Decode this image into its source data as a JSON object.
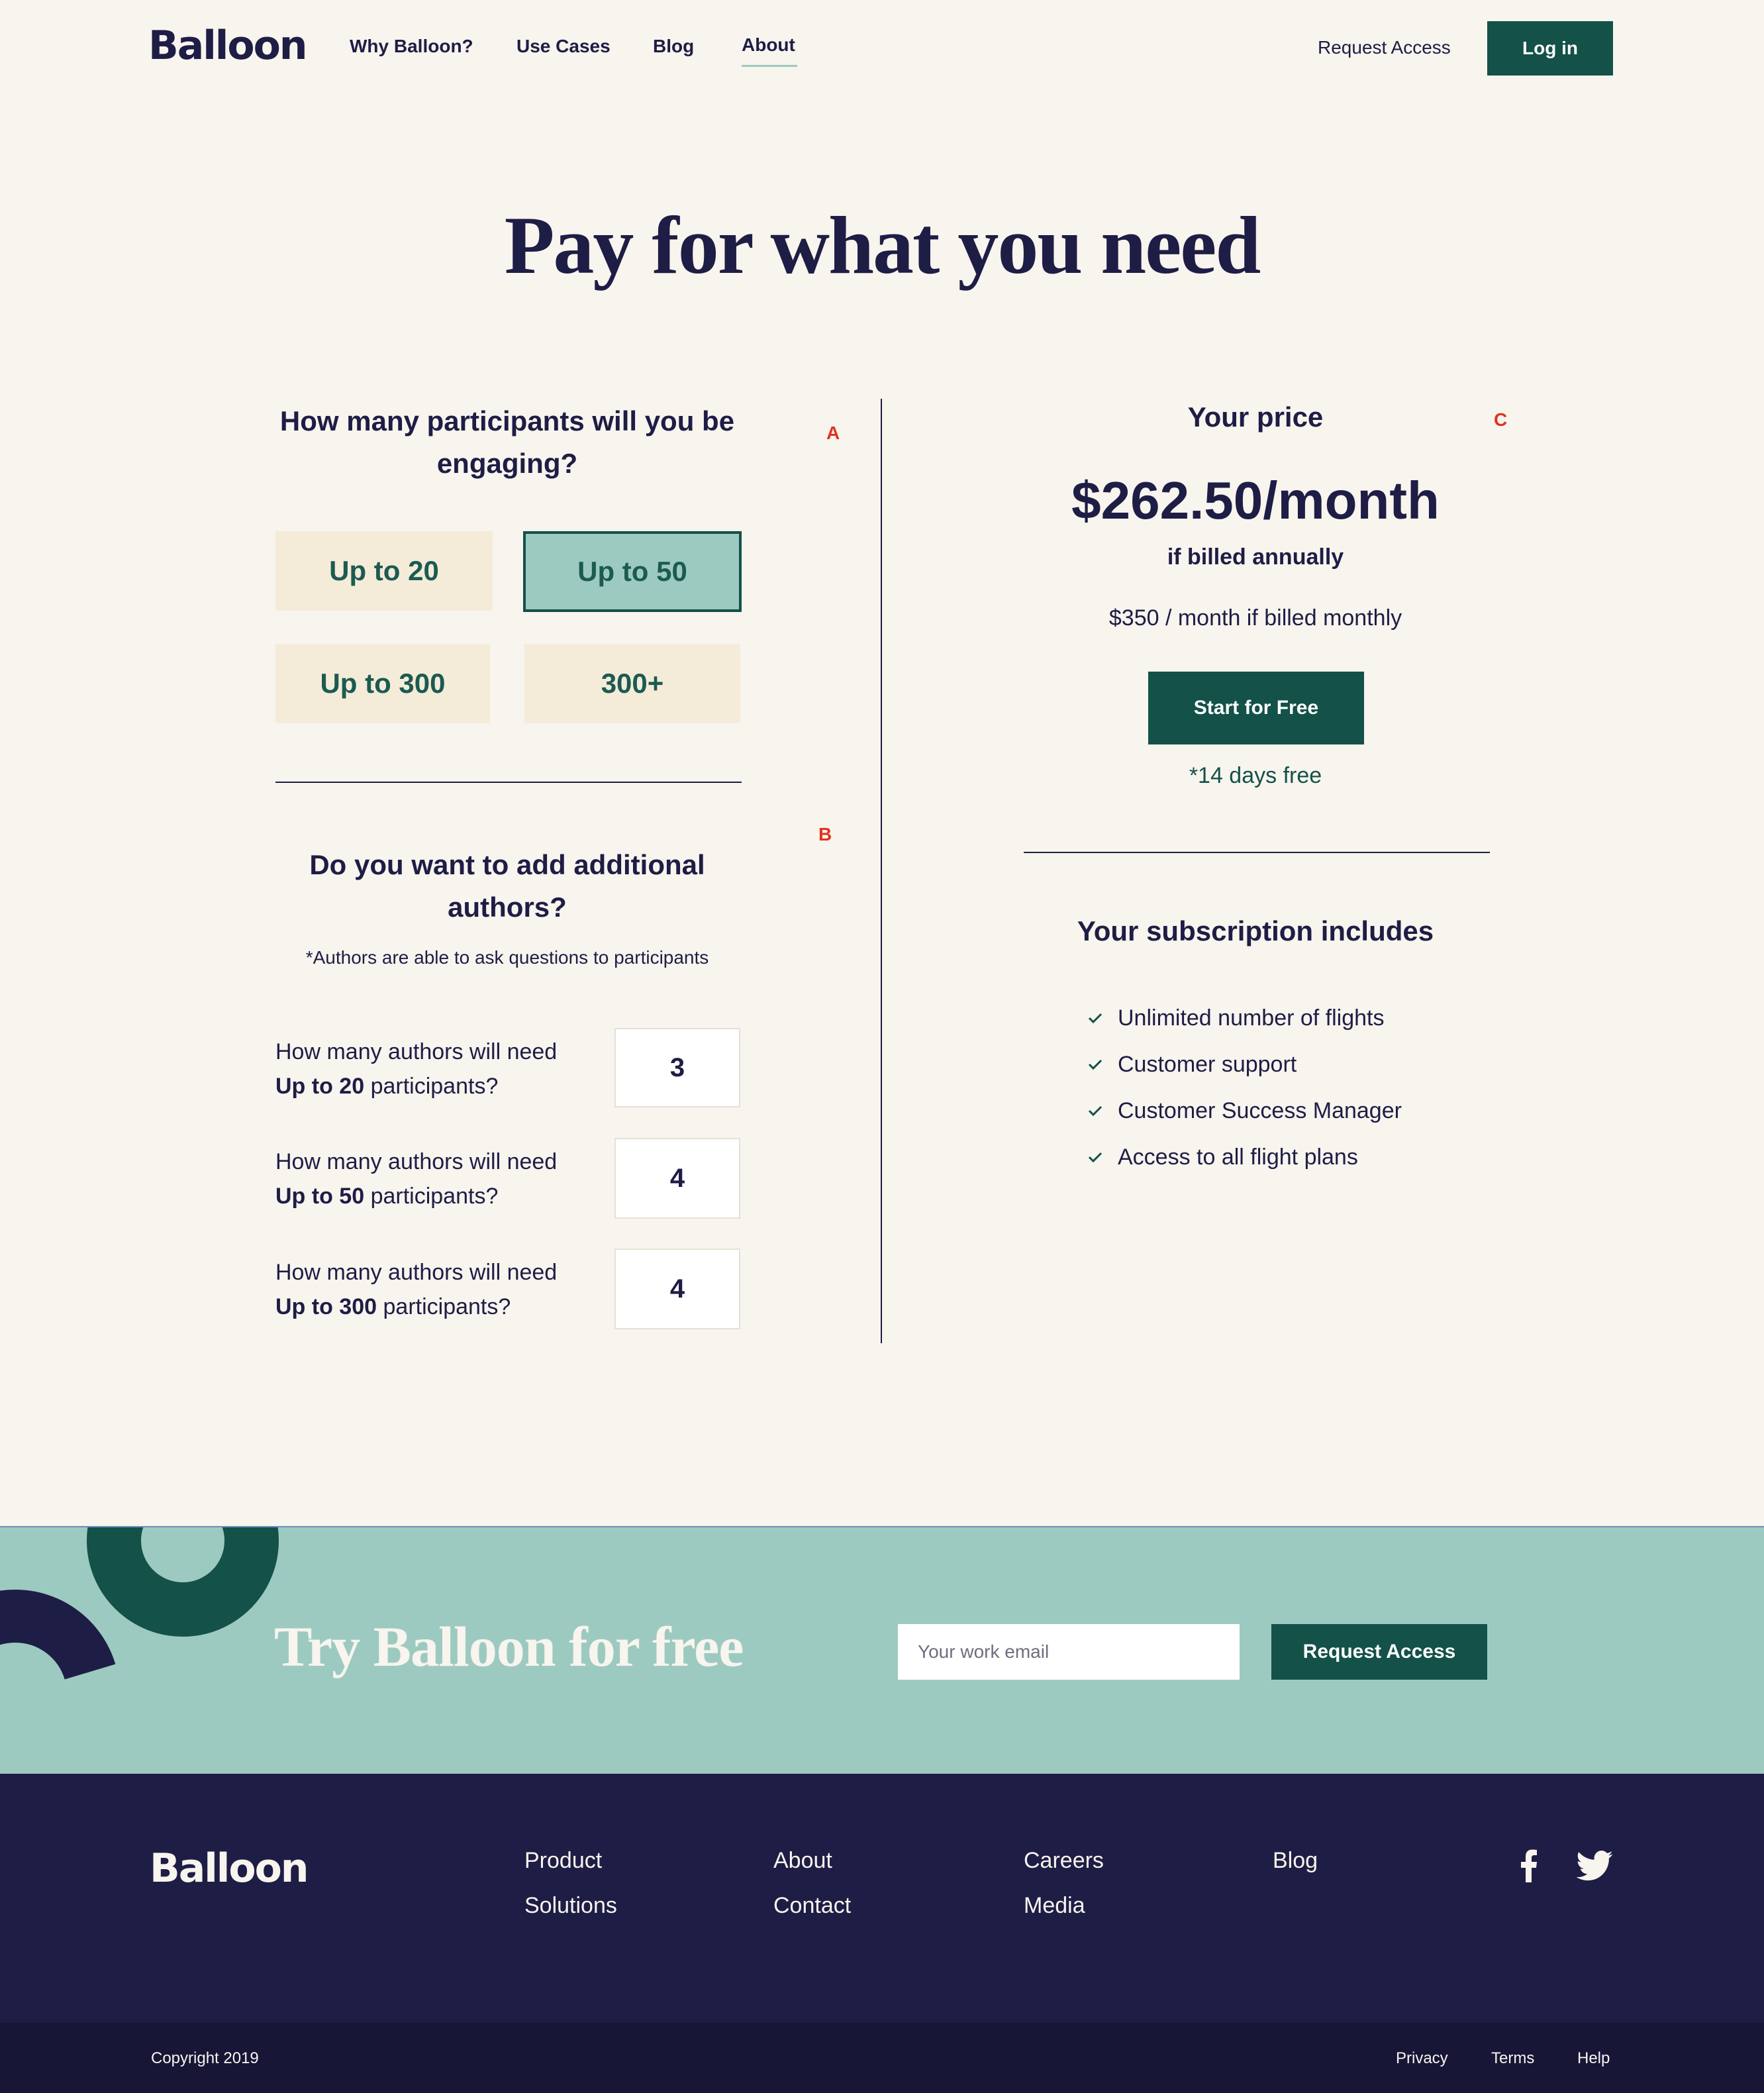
{
  "header": {
    "logo": "Balloon",
    "nav": [
      "Why Balloon?",
      "Use Cases",
      "Blog",
      "About"
    ],
    "request_access": "Request Access",
    "login": "Log in"
  },
  "headline": "Pay for what you need",
  "participants": {
    "question": "How many participants will you be engaging?",
    "marker": "A",
    "options": [
      "Up to 20",
      "Up to 50",
      "Up to 300",
      "300+"
    ],
    "selected": "Up to 50"
  },
  "authors": {
    "question": "Do you want to add additional authors?",
    "marker": "B",
    "note": "*Authors are able to ask questions to participants",
    "rows": [
      {
        "prefix": "How many authors will need",
        "tier": "Up to 20",
        "suffix": "participants?",
        "value": "3"
      },
      {
        "prefix": "How many authors will need",
        "tier": "Up to 50",
        "suffix": "participants?",
        "value": "4"
      },
      {
        "prefix": "How many authors will need",
        "tier": "Up to 300",
        "suffix": "participants?",
        "value": "4"
      }
    ]
  },
  "pricing": {
    "label": "Your price",
    "marker": "C",
    "price": "$262.50/month",
    "billed_annually": "if billed annually",
    "billed_monthly": "$350 / month if billed monthly",
    "cta": "Start for Free",
    "trial": "*14 days free",
    "includes_title": "Your subscription includes",
    "includes": [
      "Unlimited number of flights",
      "Customer support",
      "Customer Success Manager",
      "Access to all flight plans"
    ]
  },
  "cta_band": {
    "title": "Try Balloon for free",
    "email_placeholder": "Your work email",
    "button": "Request Access"
  },
  "footer": {
    "logo": "Balloon",
    "columns": [
      [
        "Product",
        "Solutions"
      ],
      [
        "About",
        "Contact"
      ],
      [
        "Careers",
        "Media"
      ],
      [
        "Blog"
      ]
    ],
    "social": [
      "facebook-icon",
      "twitter-icon"
    ],
    "copyright": "Copyright 2019",
    "bottom_links": [
      "Privacy",
      "Terms",
      "Help"
    ]
  },
  "colors": {
    "navy": "#1e1d45",
    "green": "#135149",
    "mint": "#9dcac0",
    "cream": "#f8f4ee",
    "option_bg": "#f5ebd9",
    "marker_red": "#e3311d"
  }
}
